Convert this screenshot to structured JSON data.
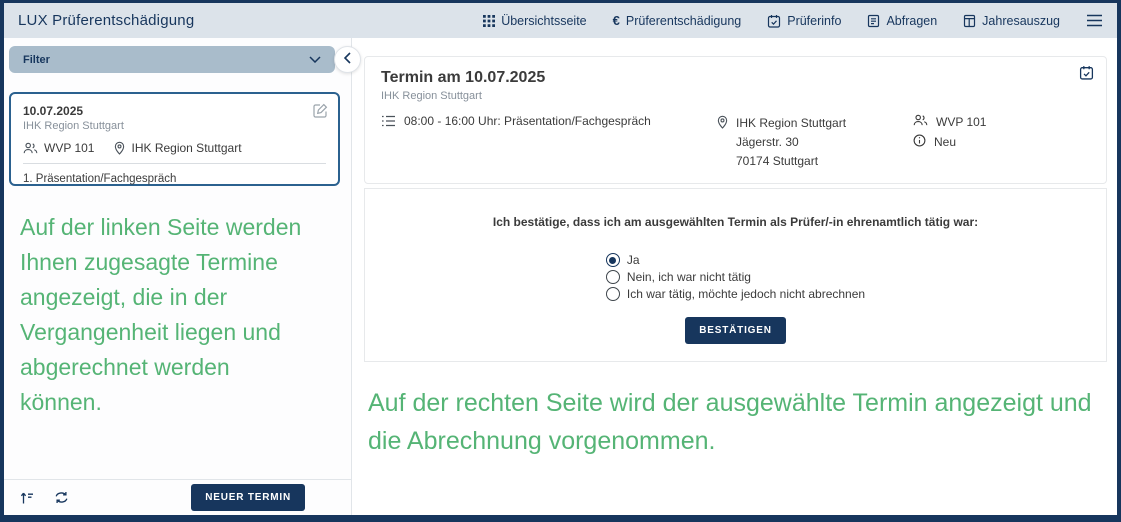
{
  "header": {
    "title": "LUX Prüferentschädigung",
    "nav": [
      {
        "label": "Übersichtsseite",
        "icon": "grid-icon"
      },
      {
        "label": "Prüferentschädigung",
        "icon": "euro-icon"
      },
      {
        "label": "Prüferinfo",
        "icon": "calendar-check-icon"
      },
      {
        "label": "Abfragen",
        "icon": "document-icon"
      },
      {
        "label": "Jahresauszug",
        "icon": "report-icon"
      }
    ],
    "menu_icon": "hamburger-menu-icon"
  },
  "sidebar": {
    "filter_label": "Filter",
    "appointment_card": {
      "date": "10.07.2025",
      "organization": "IHK Region Stuttgart",
      "group": "WVP 101",
      "location": "IHK Region Stuttgart",
      "item": "1. Präsentation/Fachgespräch"
    },
    "annotation": "Auf der linken Seite werden Ihnen zugesagte Termine angezeigt, die in der Vergangenheit liegen und abgerechnet werden können.",
    "new_appointment_label": "NEUER TERMIN"
  },
  "main": {
    "appointment": {
      "title": "Termin am 10.07.2025",
      "subtitle": "IHK Region Stuttgart",
      "time": "08:00 - 16:00 Uhr: Präsentation/Fachgespräch",
      "address": [
        "IHK Region Stuttgart",
        "Jägerstr. 30",
        "70174 Stuttgart"
      ],
      "group": "WVP 101",
      "status": "Neu"
    },
    "confirmation": {
      "question": "Ich bestätige, dass ich am ausgewählten Termin als Prüfer/-in ehrenamtlich tätig war:",
      "options": [
        {
          "label": "Ja",
          "selected": true
        },
        {
          "label": "Nein, ich war nicht tätig",
          "selected": false
        },
        {
          "label": "Ich war tätig, möchte jedoch nicht abrechnen",
          "selected": false
        }
      ],
      "confirm_label": "BESTÄTIGEN"
    },
    "annotation": "Auf der rechten Seite wird der ausgewählte Termin angezeigt und die Abrechnung vorgenommen."
  },
  "colors": {
    "navy": "#17365d",
    "header_bg": "#dce3ea",
    "filter_bg": "#a9bccb",
    "selected_card_border": "#2b618f",
    "annotation_green": "#55b475"
  }
}
